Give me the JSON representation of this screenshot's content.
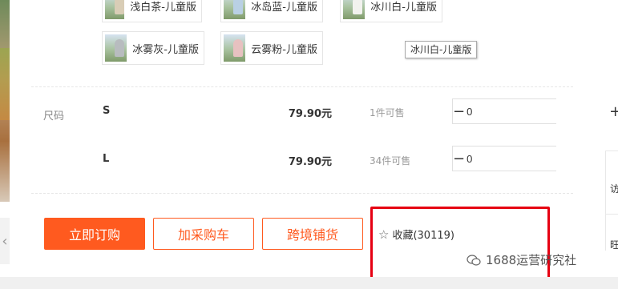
{
  "colors": {
    "accent": "#ff5a1f",
    "highlight_box": "#e60012"
  },
  "color_options": [
    {
      "label": "浅白茶-儿童版",
      "outfit": "#d9cdb6"
    },
    {
      "label": "冰岛蓝-儿童版",
      "outfit": "#b9d0e4"
    },
    {
      "label": "冰川白-儿童版",
      "outfit": "#f2f2ee"
    },
    {
      "label": "冰雾灰-儿童版",
      "outfit": "#b8bcbf"
    },
    {
      "label": "云雾粉-儿童版",
      "outfit": "#e7c1c0"
    }
  ],
  "tooltip": "冰川白-儿童版",
  "size_section": {
    "title": "尺码",
    "rows": [
      {
        "size": "S",
        "price": "79.90元",
        "stock": "1件可售",
        "quantity": "0"
      },
      {
        "size": "L",
        "price": "79.90元",
        "stock": "34件可售",
        "quantity": "0"
      }
    ],
    "minus_symbol": "−",
    "plus_symbol": "+"
  },
  "actions": {
    "buy_now": "立即订购",
    "add_to_cart": "加采购车",
    "cross_border": "跨境铺货",
    "favorite": "收藏(30119)"
  },
  "watermark": "1688运营研究社",
  "right_panel": {
    "char1": "访",
    "char2": "旺"
  },
  "icons": {
    "left_arrow": "chevron-left-icon",
    "favorite": "star-outline-icon",
    "watermark": "wechat-icon"
  }
}
